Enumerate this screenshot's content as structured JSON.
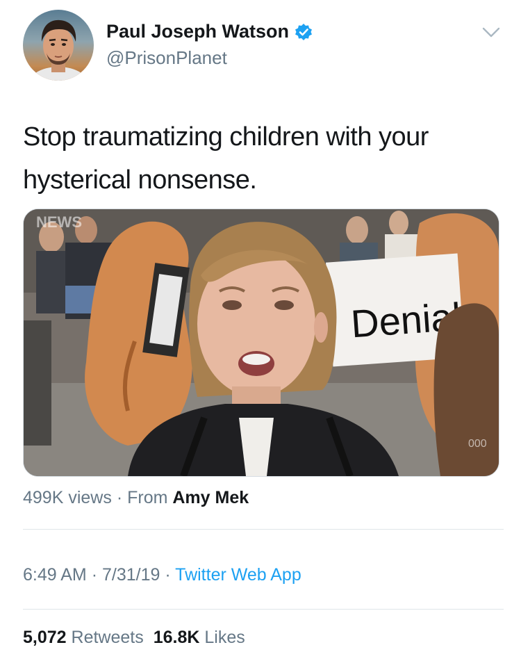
{
  "author": {
    "display_name": "Paul Joseph Watson",
    "handle": "@PrisonPlanet",
    "verified": true
  },
  "tweet": {
    "line1": "Stop traumatizing children with your",
    "line2": "hysterical nonsense."
  },
  "media": {
    "watermark": "NEWS",
    "sign_text": "Denial",
    "corner_mark": "000",
    "views": "499K views",
    "from_label": "From",
    "from_name": "Amy Mek",
    "separator": "·"
  },
  "meta": {
    "time": "6:49 AM",
    "date": "7/31/19",
    "source": "Twitter Web App",
    "separator": "·"
  },
  "engagement": {
    "retweets_count": "5,072",
    "retweets_label": "Retweets",
    "likes_count": "16.8K",
    "likes_label": "Likes"
  },
  "colors": {
    "verified_blue": "#1da1f2",
    "link_blue": "#1da1f2",
    "secondary_text": "#657786"
  },
  "icons": [
    "verified-badge-icon",
    "chevron-down-icon"
  ]
}
